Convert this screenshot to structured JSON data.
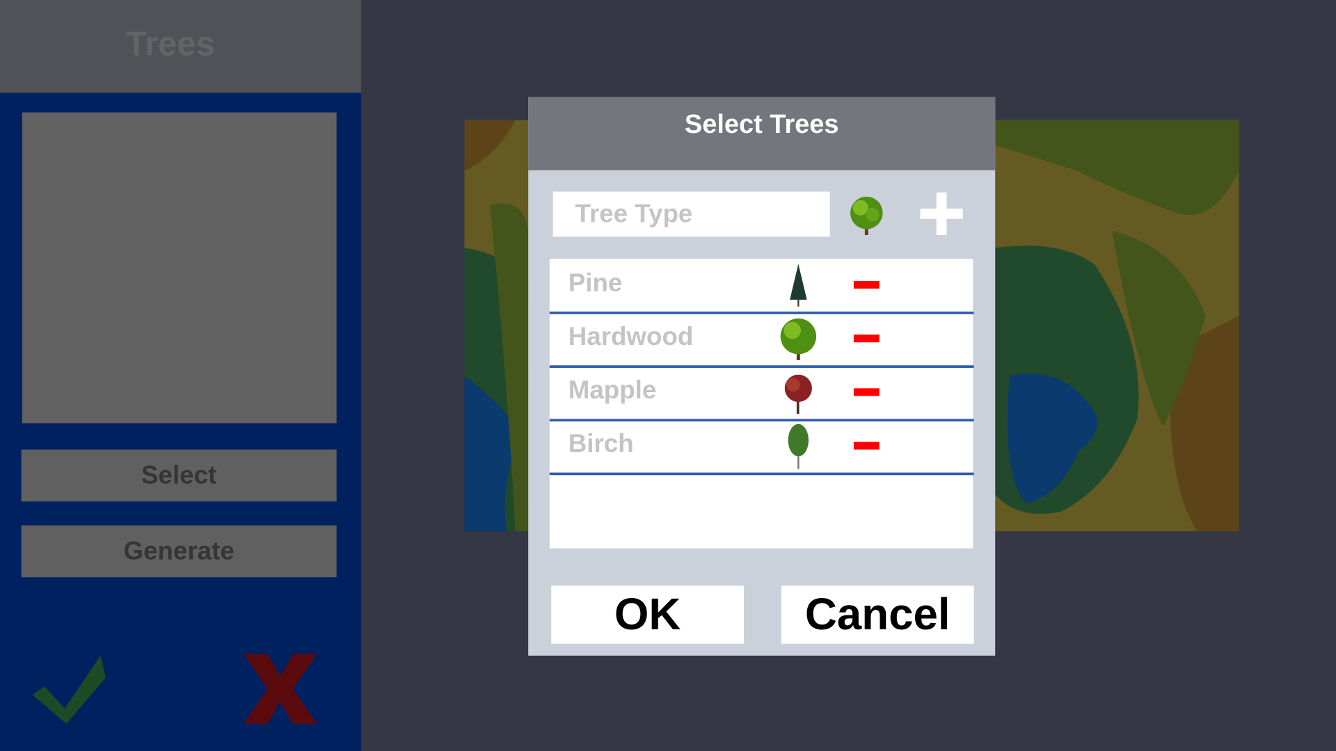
{
  "sidebar": {
    "title": "Trees",
    "select_label": "Select",
    "generate_label": "Generate",
    "confirm_icon": "checkmark-icon",
    "cancel_icon": "x-icon"
  },
  "dialog": {
    "title": "Select Trees",
    "input": {
      "placeholder": "Tree Type",
      "value": ""
    },
    "add_icon": "plus-icon",
    "items": [
      {
        "label": "Pine",
        "icon": "pine-tree-icon"
      },
      {
        "label": "Hardwood",
        "icon": "hardwood-tree-icon"
      },
      {
        "label": "Mapple",
        "icon": "maple-tree-icon"
      },
      {
        "label": "Birch",
        "icon": "birch-tree-icon"
      }
    ],
    "ok_label": "OK",
    "cancel_label": "Cancel"
  },
  "colors": {
    "sidebar": "#00215f",
    "dialog": "#cbd1da",
    "dialog_header": "#73767d",
    "divider": "#2f5bb0",
    "remove": "#ff0000"
  }
}
